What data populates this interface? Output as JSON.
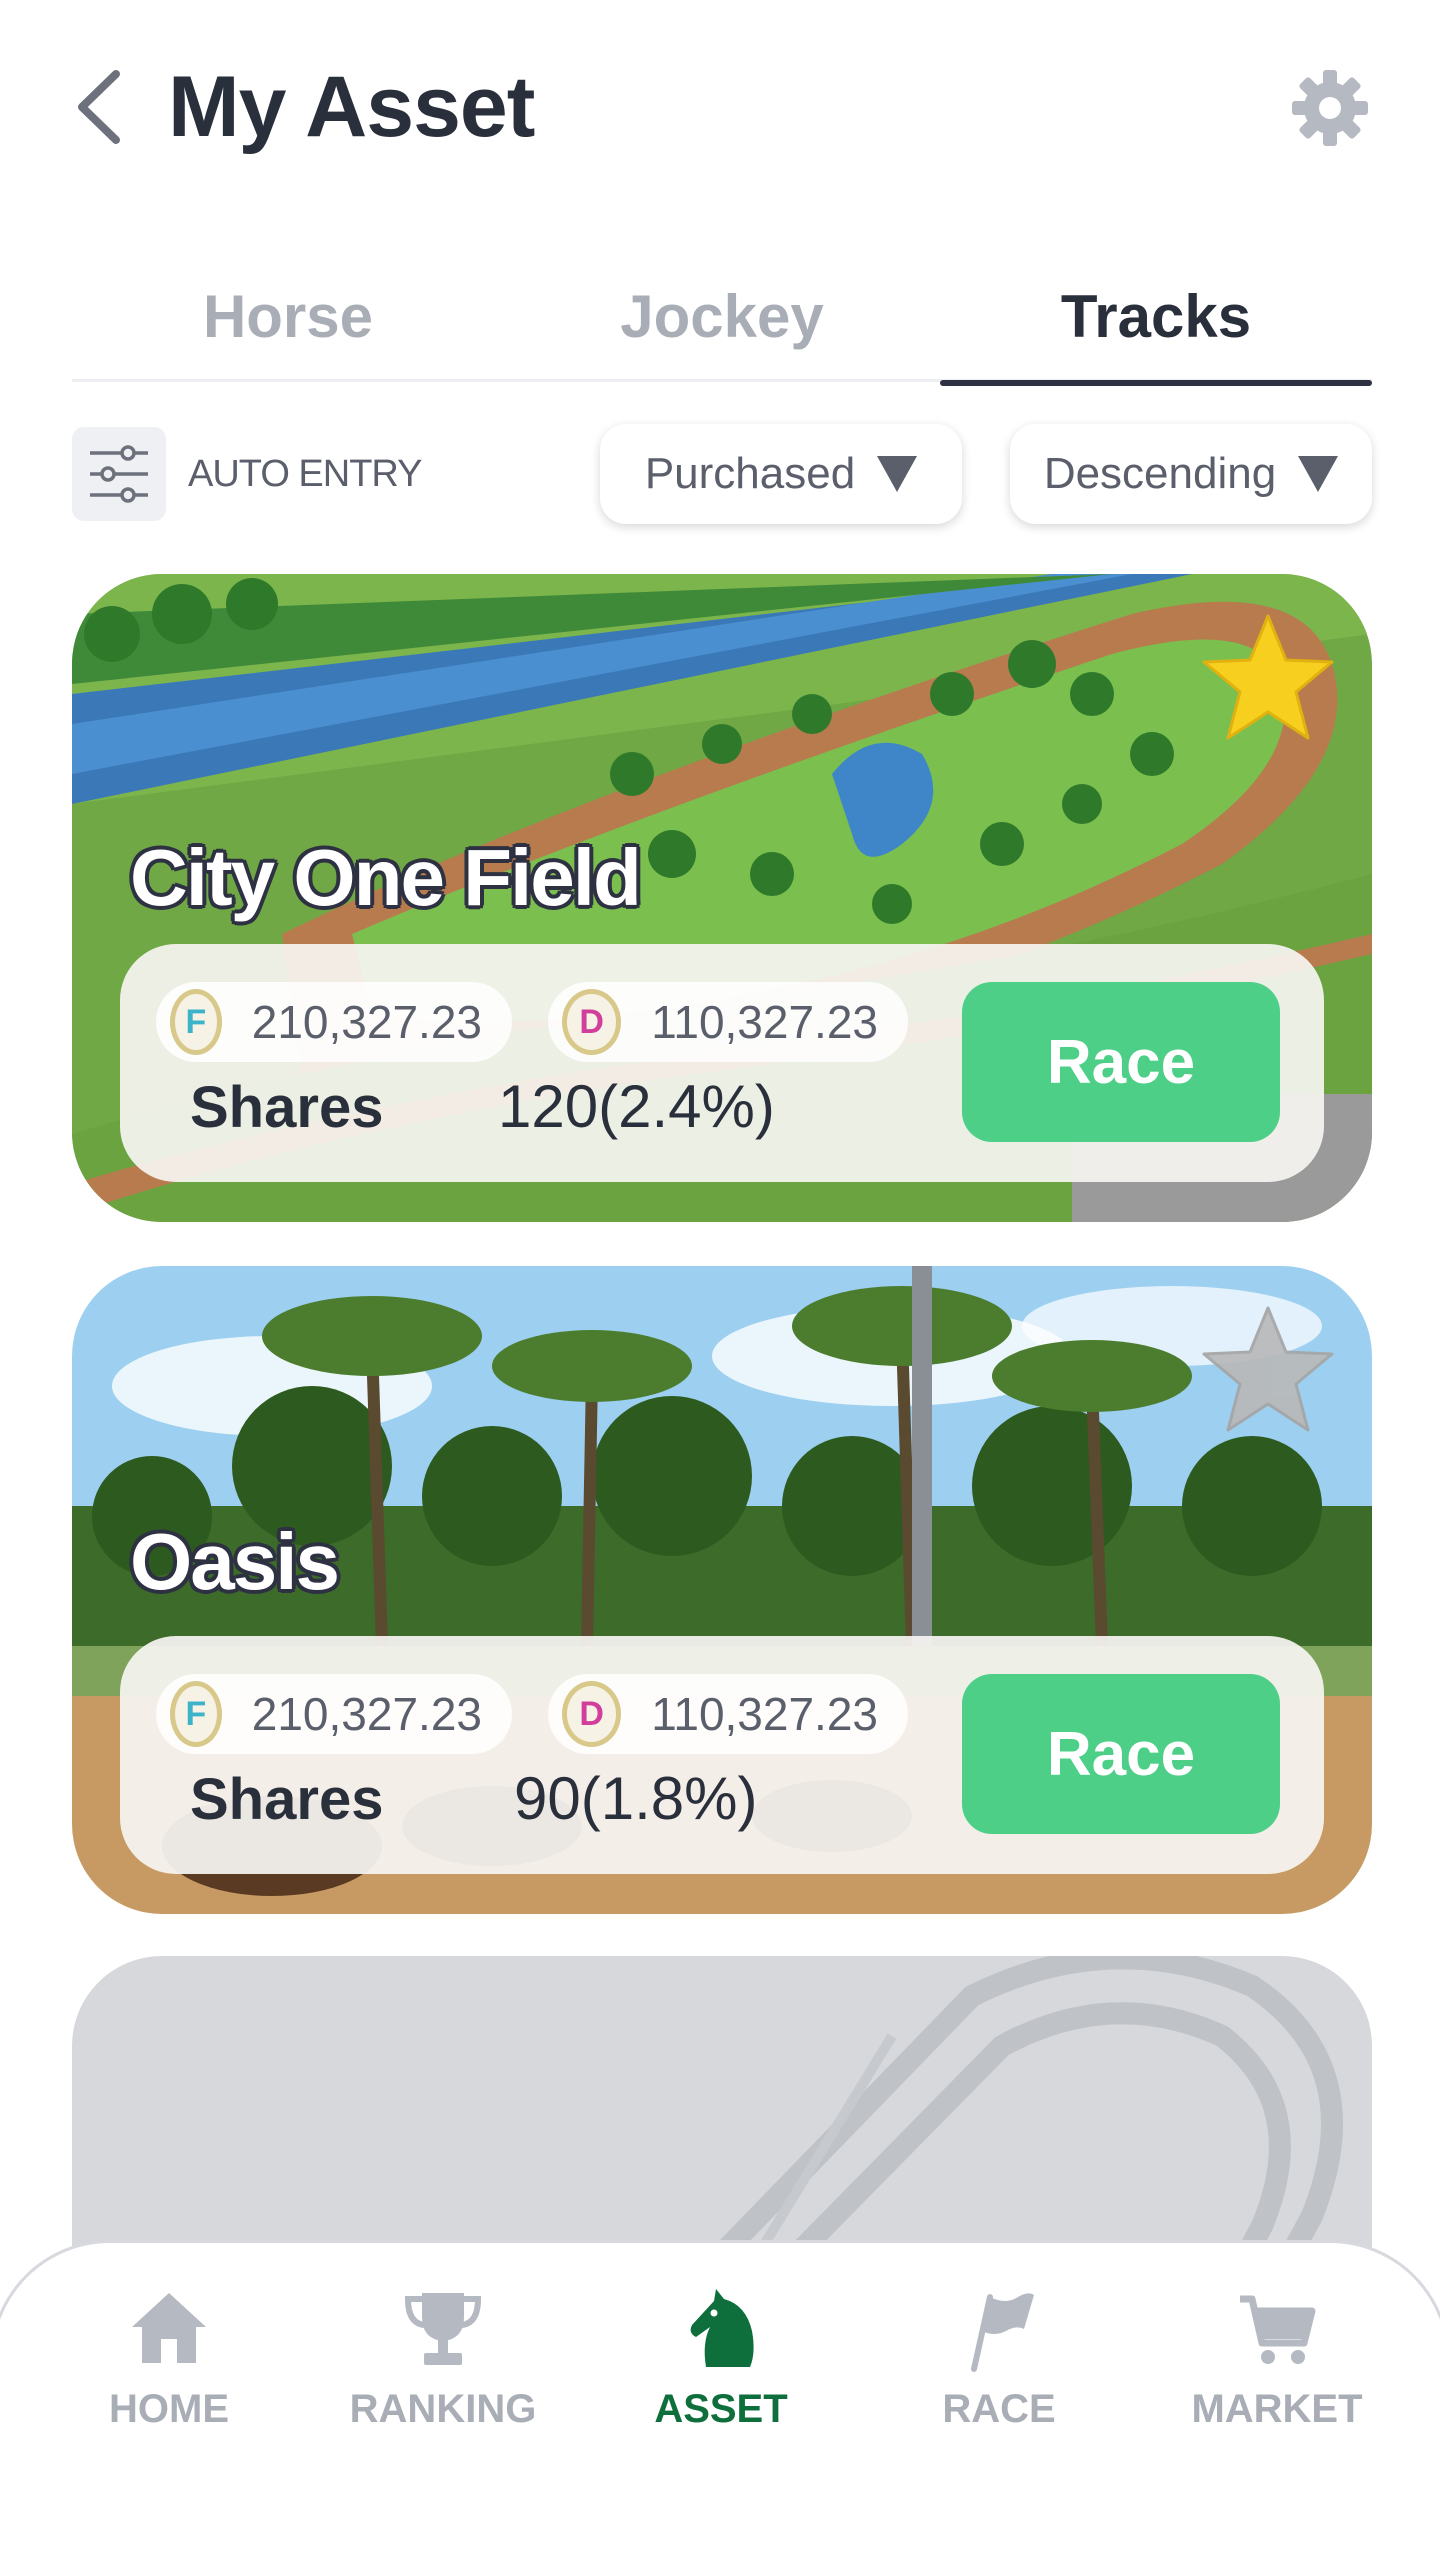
{
  "header": {
    "title": "My Asset",
    "back_icon": "chevron-left-icon",
    "settings_icon": "gear-icon"
  },
  "tabs": [
    {
      "label": "Horse",
      "active": false
    },
    {
      "label": "Jockey",
      "active": false
    },
    {
      "label": "Tracks",
      "active": true
    }
  ],
  "filters": {
    "auto_entry_label": "AUTO ENTRY",
    "auto_entry_icon": "sliders-icon",
    "sort_by": "Purchased",
    "order": "Descending"
  },
  "cards": [
    {
      "name": "City One Field",
      "favorite": true,
      "f_coin_symbol": "F",
      "f_value": "210,327.23",
      "d_coin_symbol": "D",
      "d_value": "110,327.23",
      "shares_label": "Shares",
      "shares_value": "120(2.4%)",
      "race_label": "Race"
    },
    {
      "name": "Oasis",
      "favorite": false,
      "f_coin_symbol": "F",
      "f_value": "210,327.23",
      "d_coin_symbol": "D",
      "d_value": "110,327.23",
      "shares_label": "Shares",
      "shares_value": "90(1.8%)",
      "race_label": "Race"
    }
  ],
  "bottom_nav": [
    {
      "label": "HOME",
      "icon": "home-icon",
      "active": false
    },
    {
      "label": "RANKING",
      "icon": "trophy-icon",
      "active": false
    },
    {
      "label": "ASSET",
      "icon": "horse-head-icon",
      "active": true
    },
    {
      "label": "RACE",
      "icon": "flag-icon",
      "active": false
    },
    {
      "label": "MARKET",
      "icon": "cart-icon",
      "active": false
    }
  ],
  "colors": {
    "accent_green": "#4ecf88",
    "nav_active": "#0f6f3c",
    "favorite_star": "#f7cf1e",
    "text_dark": "#2a2f3c",
    "text_muted": "#a9adb6"
  }
}
